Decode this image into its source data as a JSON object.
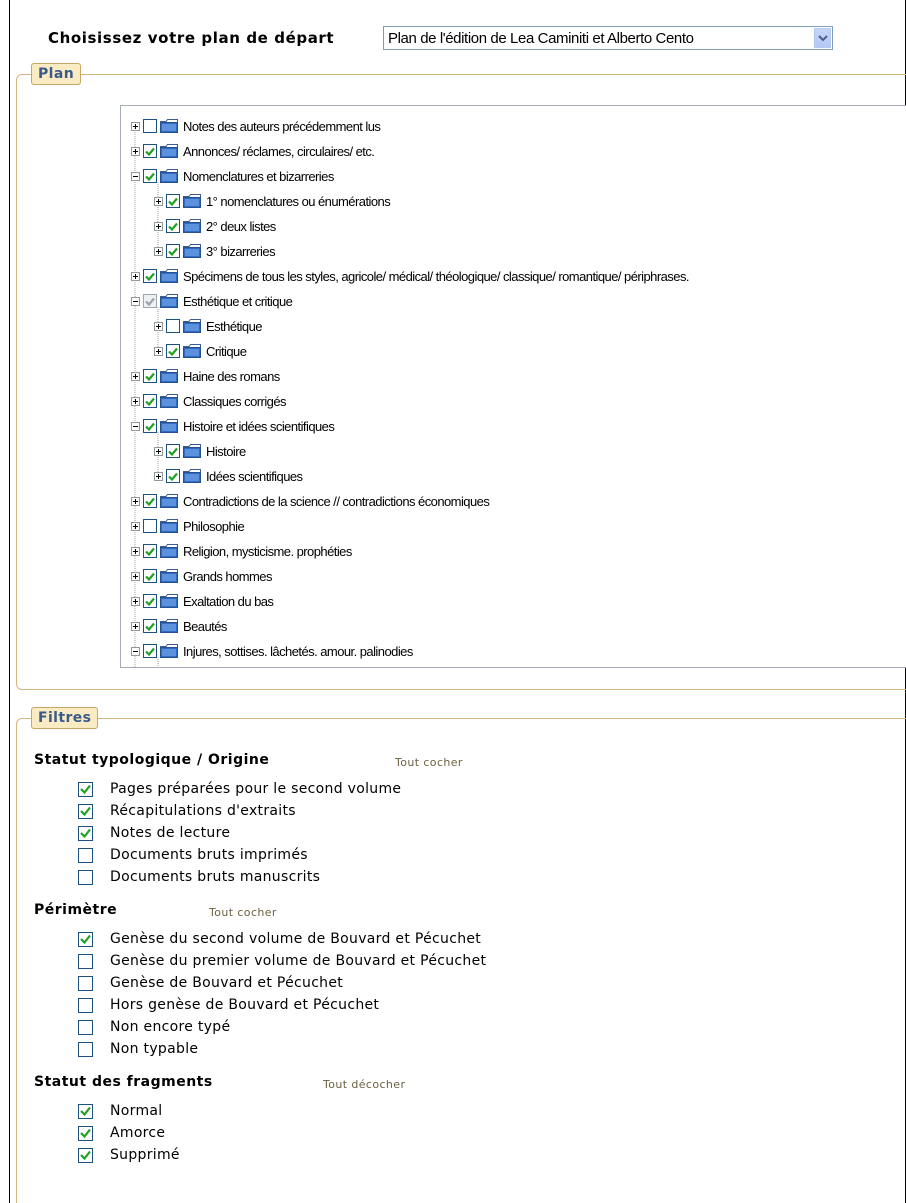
{
  "header": {
    "label": "Choisissez votre plan de départ",
    "plan_select_value": "Plan de l'édition de Lea Caminiti et Alberto Cento"
  },
  "plan": {
    "legend": "Plan",
    "tree": [
      {
        "label": "Notes des auteurs précédemment lus",
        "level": 0,
        "checked": false,
        "expanded": false
      },
      {
        "label": "Annonces/ réclames, circulaires/ etc.",
        "level": 0,
        "checked": true,
        "expanded": false
      },
      {
        "label": "Nomenclatures et bizarreries",
        "level": 0,
        "checked": true,
        "expanded": true
      },
      {
        "label": "1° nomenclatures ou énumérations",
        "level": 1,
        "checked": true,
        "expanded": false
      },
      {
        "label": "2° deux listes",
        "level": 1,
        "checked": true,
        "expanded": false
      },
      {
        "label": "3° bizarreries",
        "level": 1,
        "checked": true,
        "expanded": false
      },
      {
        "label": "Spécimens de tous les styles, agricole/ médical/ théologique/ classique/ romantique/ périphrases.",
        "level": 0,
        "checked": true,
        "expanded": false
      },
      {
        "label": "Esthétique et critique",
        "level": 0,
        "checked": "partial",
        "expanded": true
      },
      {
        "label": "Esthétique",
        "level": 1,
        "checked": false,
        "expanded": false
      },
      {
        "label": "Critique",
        "level": 1,
        "checked": true,
        "expanded": false
      },
      {
        "label": "Haine des romans",
        "level": 0,
        "checked": true,
        "expanded": false
      },
      {
        "label": "Classiques corrigés",
        "level": 0,
        "checked": true,
        "expanded": false
      },
      {
        "label": "Histoire et idées scientifiques",
        "level": 0,
        "checked": true,
        "expanded": true
      },
      {
        "label": "Histoire",
        "level": 1,
        "checked": true,
        "expanded": false
      },
      {
        "label": "Idées scientifiques",
        "level": 1,
        "checked": true,
        "expanded": false
      },
      {
        "label": "Contradictions de la science // contradictions économiques",
        "level": 0,
        "checked": true,
        "expanded": false
      },
      {
        "label": "Philosophie",
        "level": 0,
        "checked": false,
        "expanded": false
      },
      {
        "label": "Religion, mysticisme. prophéties",
        "level": 0,
        "checked": true,
        "expanded": false
      },
      {
        "label": "Grands hommes",
        "level": 0,
        "checked": true,
        "expanded": false
      },
      {
        "label": "Exaltation du bas",
        "level": 0,
        "checked": true,
        "expanded": false
      },
      {
        "label": "Beautés",
        "level": 0,
        "checked": true,
        "expanded": false
      },
      {
        "label": "Injures, sottises. lâchetés. amour. palinodies",
        "level": 0,
        "checked": true,
        "expanded": true
      },
      {
        "label": "",
        "level": 1,
        "checked": true,
        "expanded": false
      }
    ]
  },
  "filters": {
    "legend": "Filtres",
    "groups": [
      {
        "title": "Statut typologique / Origine",
        "toggle": "Tout cocher",
        "options": [
          {
            "label": "Pages préparées pour le second volume",
            "checked": true
          },
          {
            "label": "Récapitulations d'extraits",
            "checked": true
          },
          {
            "label": "Notes de lecture",
            "checked": true
          },
          {
            "label": "Documents bruts imprimés",
            "checked": false
          },
          {
            "label": "Documents bruts manuscrits",
            "checked": false
          }
        ]
      },
      {
        "title": "Périmètre",
        "toggle": "Tout cocher",
        "options": [
          {
            "label": "Genèse du second volume de Bouvard et Pécuchet",
            "checked": true
          },
          {
            "label": "Genèse du premier volume de Bouvard et Pécuchet",
            "checked": false
          },
          {
            "label": "Genèse de Bouvard et Pécuchet",
            "checked": false
          },
          {
            "label": "Hors genèse de Bouvard et Pécuchet",
            "checked": false
          },
          {
            "label": "Non encore typé",
            "checked": false
          },
          {
            "label": "Non typable",
            "checked": false
          }
        ]
      },
      {
        "title": "Statut des fragments",
        "toggle": "Tout décocher",
        "options": [
          {
            "label": "Normal",
            "checked": true
          },
          {
            "label": "Amorce",
            "checked": true
          },
          {
            "label": "Supprimé",
            "checked": true
          }
        ]
      }
    ]
  },
  "colors": {
    "check_green": "#21a121",
    "folder_blue": "#2d6bc4",
    "legend_text": "#3a5b8c",
    "legend_bg": "#fbebc3",
    "fieldset_border": "#d6b680"
  }
}
